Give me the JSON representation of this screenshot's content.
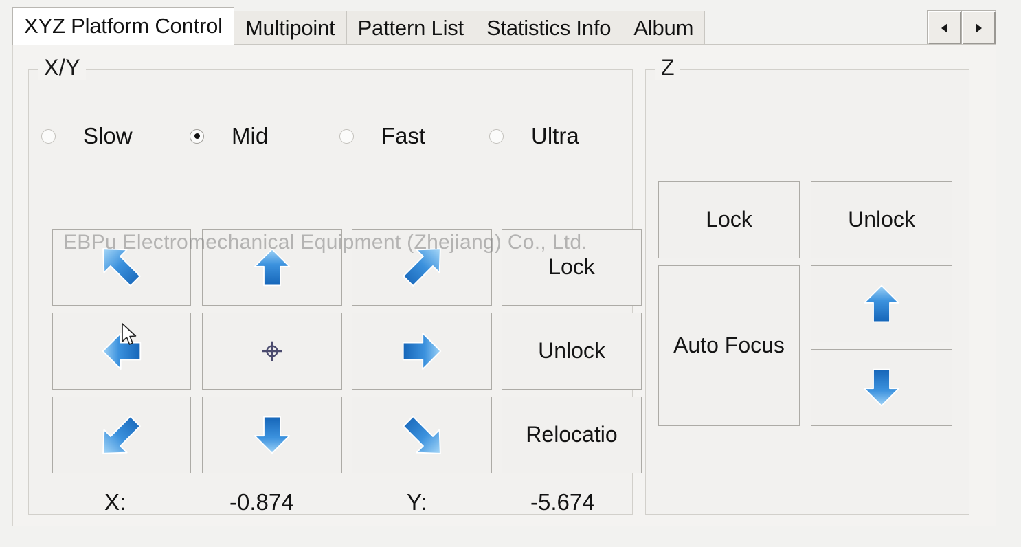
{
  "window": {
    "watermark": "EBPu Electromechanical Equipment (Zhejiang) Co., Ltd."
  },
  "tabs": {
    "items": [
      {
        "label": "XYZ Platform Control",
        "active": true
      },
      {
        "label": "Multipoint",
        "active": false
      },
      {
        "label": "Pattern List",
        "active": false
      },
      {
        "label": "Statistics Info",
        "active": false
      },
      {
        "label": "Album",
        "active": false
      }
    ],
    "scroll_prev": "‹",
    "scroll_next": "›"
  },
  "xy_group": {
    "legend": "X/Y",
    "speed_options": [
      {
        "label": "Slow",
        "selected": false
      },
      {
        "label": "Mid",
        "selected": true
      },
      {
        "label": "Fast",
        "selected": false
      },
      {
        "label": "Ultra",
        "selected": false
      }
    ],
    "buttons": {
      "up_left": "arrow-up-left-icon",
      "up": "arrow-up-icon",
      "up_right": "arrow-up-right-icon",
      "lock": "Lock",
      "left": "arrow-left-icon",
      "center": "crosshair-target-icon",
      "right": "arrow-right-icon",
      "unlock": "Unlock",
      "down_left": "arrow-down-left-icon",
      "down": "arrow-down-icon",
      "down_right": "arrow-down-right-icon",
      "relocation": "Relocatio"
    },
    "readout": {
      "x_label": "X:",
      "x_value": "-0.874",
      "y_label": "Y:",
      "y_value": "-5.674"
    }
  },
  "z_group": {
    "legend": "Z",
    "buttons": {
      "lock": "Lock",
      "unlock": "Unlock",
      "auto_focus": "Auto Focus",
      "up": "arrow-up-icon",
      "down": "arrow-down-icon"
    }
  },
  "colors": {
    "arrow_blue_light": "#7ec2f0",
    "arrow_blue_dark": "#1f6fc4",
    "crosshair": "#4b4b6e",
    "panel_bg": "#f4f3f1",
    "button_bg": "#f1f0ee",
    "button_border": "#adaba6",
    "text": "#141414"
  }
}
